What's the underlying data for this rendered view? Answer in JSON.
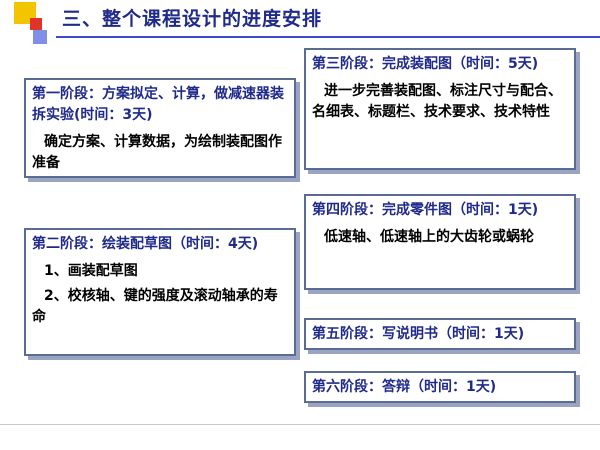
{
  "colors": {
    "title": "#1f2a8a",
    "square_yellow": "#f2c500",
    "square_red": "#e0342a",
    "square_blue": "#7f8ee6",
    "border": "#5a6c93"
  },
  "slide": {
    "title": "三、整个课程设计的进度安排"
  },
  "stages": {
    "s1": {
      "head": "第一阶段：方案拟定、计算，做减速器装拆实验(时间：3天)",
      "body": "确定方案、计算数据，为绘制装配图作准备"
    },
    "s2": {
      "head": "第二阶段：绘装配草图（时间：4天)",
      "item1": "1、画装配草图",
      "item2": "2、校核轴、键的强度及滚动轴承的寿命"
    },
    "s3": {
      "head": "第三阶段：完成装配图（时间：5天)",
      "body": "进一步完善装配图、标注尺寸与配合、名细表、标题栏、技术要求、技术特性"
    },
    "s4": {
      "head": "第四阶段：完成零件图（时间：1天)",
      "body": "低速轴、低速轴上的大齿轮或蜗轮"
    },
    "s5": {
      "head": "第五阶段：写说明书（时间：1天)"
    },
    "s6": {
      "head": "第六阶段：答辩（时间：1天)"
    }
  }
}
